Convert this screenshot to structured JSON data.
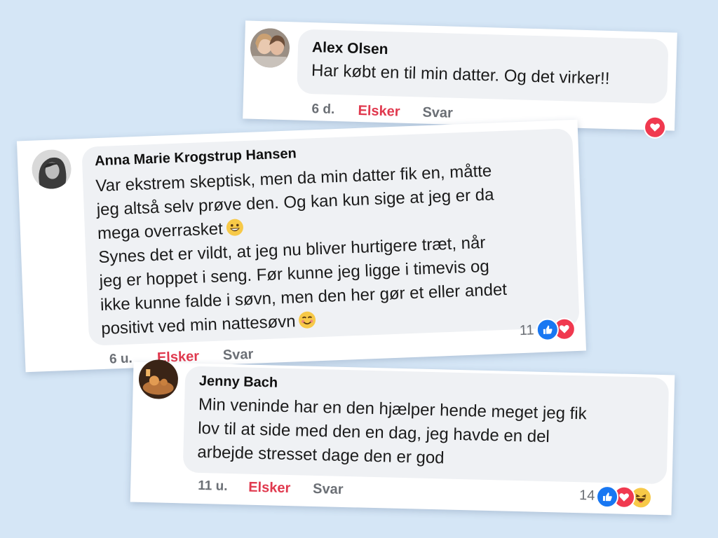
{
  "colors": {
    "background": "#d5e6f6",
    "love": "#e0394e",
    "like": "#1877f2",
    "bubble": "#eff1f4"
  },
  "comments": [
    {
      "author": "Alex Olsen",
      "lines": [
        "Har købt en til min datter. Og det virker!!"
      ],
      "time": "6 d.",
      "reaction_action": "Elsker",
      "reply_action": "Svar",
      "reaction_count": "",
      "reactions": [
        "love-icon"
      ]
    },
    {
      "author": "Anna Marie Krogstrup Hansen",
      "lines": [
        "Var ekstrem skeptisk, men da min datter fik en, måtte",
        "jeg altså selv prøve den. Og kan kun sige at jeg er da",
        "mega overrasket",
        "Synes det er vildt, at jeg nu bliver hurtigere træt, når",
        "jeg er hoppet i seng. Før kunne jeg ligge i timevis og",
        "ikke kunne falde i søvn, men den her gør et eller andet",
        "positivt ved min nattesøvn"
      ],
      "time": "6 u.",
      "reaction_action": "Elsker",
      "reply_action": "Svar",
      "reaction_count": "11",
      "reactions": [
        "like-icon",
        "love-icon"
      ]
    },
    {
      "author": "Jenny Bach",
      "lines": [
        "Min veninde har en den hjælper hende meget jeg fik",
        "lov til at side med den en dag, jeg havde en del",
        "arbejde stresset dage den er god"
      ],
      "time": "11 u.",
      "reaction_action": "Elsker",
      "reply_action": "Svar",
      "reaction_count": "14",
      "reactions": [
        "like-icon",
        "love-icon",
        "haha-icon"
      ]
    }
  ]
}
